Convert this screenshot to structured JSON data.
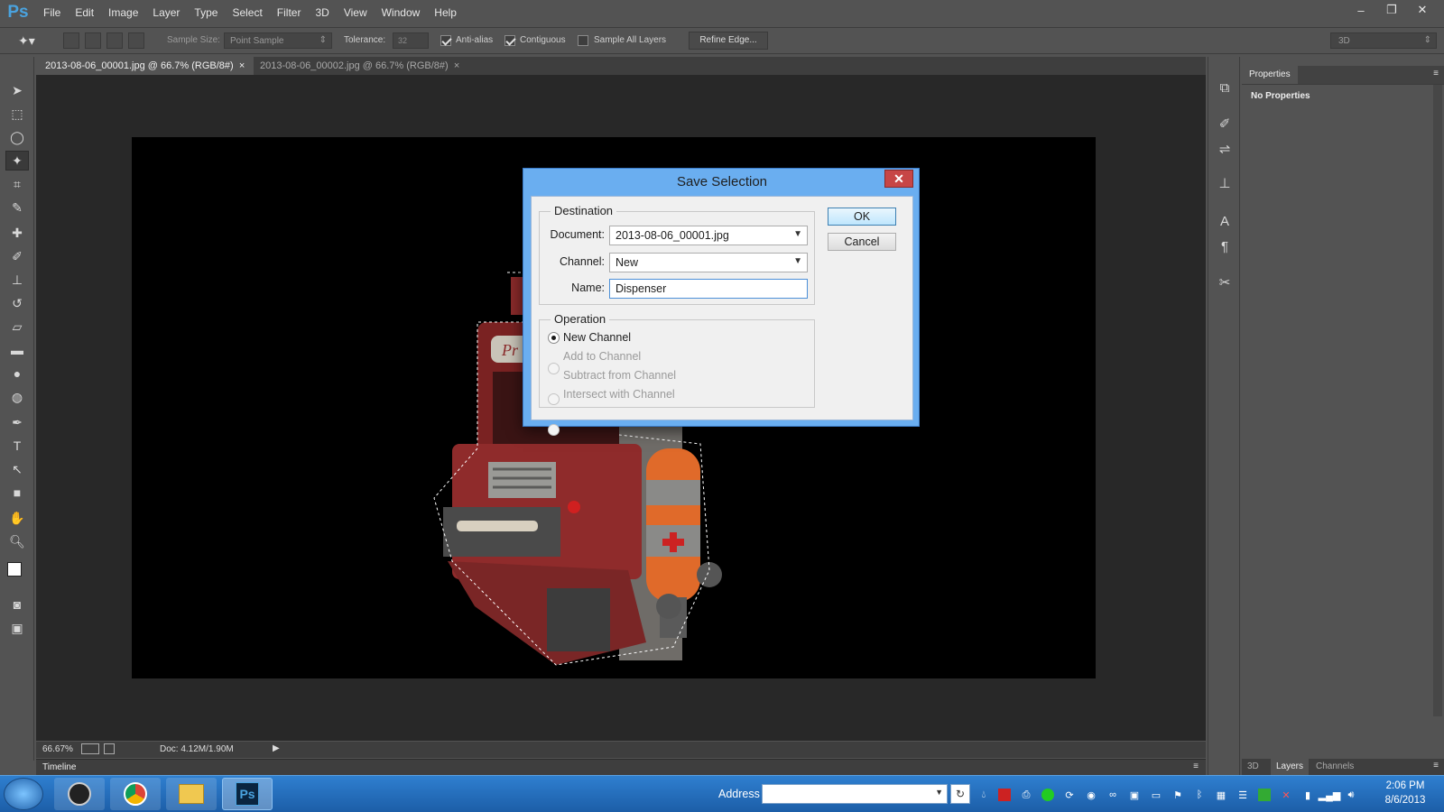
{
  "app": {
    "logo": "Ps"
  },
  "menu": [
    "File",
    "Edit",
    "Image",
    "Layer",
    "Type",
    "Select",
    "Filter",
    "3D",
    "View",
    "Window",
    "Help"
  ],
  "window_controls": {
    "minimize": "–",
    "restore": "❐",
    "close": "✕"
  },
  "options": {
    "sample_size_label": "Sample Size:",
    "sample_size_value": "Point Sample",
    "tolerance_label": "Tolerance:",
    "tolerance_value": "32",
    "antialias_label": "Anti-alias",
    "antialias_checked": true,
    "contiguous_label": "Contiguous",
    "contiguous_checked": true,
    "sample_all_layers_label": "Sample All Layers",
    "sample_all_layers_checked": false,
    "refine_edge_label": "Refine Edge...",
    "workspace_value": "3D"
  },
  "tabs": [
    {
      "label": "2013-08-06_00001.jpg @ 66.7% (RGB/8#)",
      "close": "×",
      "active": true
    },
    {
      "label": "2013-08-06_00002.jpg @ 66.7% (RGB/8#)",
      "close": "×",
      "active": false
    }
  ],
  "status": {
    "zoom": "66.67%",
    "doc": "Doc: 4.12M/1.90M"
  },
  "timeline": {
    "label": "Timeline"
  },
  "properties": {
    "tab": "Properties",
    "body": "No Properties"
  },
  "bottom_panel_tabs": [
    "3D",
    "Layers",
    "Channels"
  ],
  "dialog": {
    "title": "Save Selection",
    "close": "✕",
    "destination_label": "Destination",
    "document_label": "Document:",
    "document_value": "2013-08-06_00001.jpg",
    "channel_label": "Channel:",
    "channel_value": "New",
    "name_label": "Name:",
    "name_value": "Dispenser",
    "operation_label": "Operation",
    "operations": [
      {
        "label": "New Channel",
        "selected": true,
        "enabled": true
      },
      {
        "label": "Add to Channel",
        "selected": false,
        "enabled": false
      },
      {
        "label": "Subtract from Channel",
        "selected": false,
        "enabled": false
      },
      {
        "label": "Intersect with Channel",
        "selected": false,
        "enabled": false
      }
    ],
    "ok_label": "OK",
    "cancel_label": "Cancel"
  },
  "taskbar": {
    "address_label": "Address",
    "time": "2:06 PM",
    "date": "8/6/2013"
  }
}
